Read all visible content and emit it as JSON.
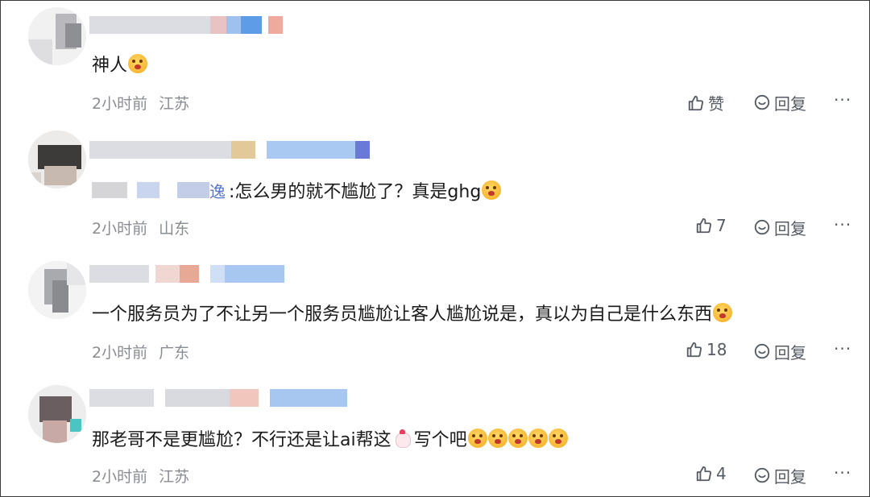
{
  "comments": [
    {
      "text": "神人",
      "emojis": 1,
      "time": "2小时前",
      "location": "江苏",
      "like_label": "赞",
      "reply_label": "回复",
      "more_label": "···"
    },
    {
      "reply_target_suffix": "逸",
      "text": ":怎么男的就不尴尬了？真是ghg",
      "emojis": 1,
      "time": "2小时前",
      "location": "山东",
      "like_label": "7",
      "reply_label": "回复",
      "more_label": "···"
    },
    {
      "text": "一个服务员为了不让另一个服务员尴尬让客人尴尬说是，真以为自己是什么东西",
      "emojis": 1,
      "time": "2小时前",
      "location": "广东",
      "like_label": "18",
      "reply_label": "回复",
      "more_label": "···"
    },
    {
      "text": "那老哥不是更尴尬？不行还是让ai帮这",
      "text_after": "写个吧",
      "emojis": 5,
      "time": "2小时前",
      "location": "江苏",
      "like_label": "4",
      "reply_label": "回复",
      "more_label": "···"
    }
  ],
  "icons": {
    "like": "thumbs-up-icon",
    "reply": "chat-bubble-icon",
    "emoji": "surprised-face-emoji-icon",
    "chick": "chicken-emoji-icon"
  },
  "colors": {
    "text": "#1a1a1a",
    "meta": "#8a8c93",
    "action": "#555a63"
  }
}
